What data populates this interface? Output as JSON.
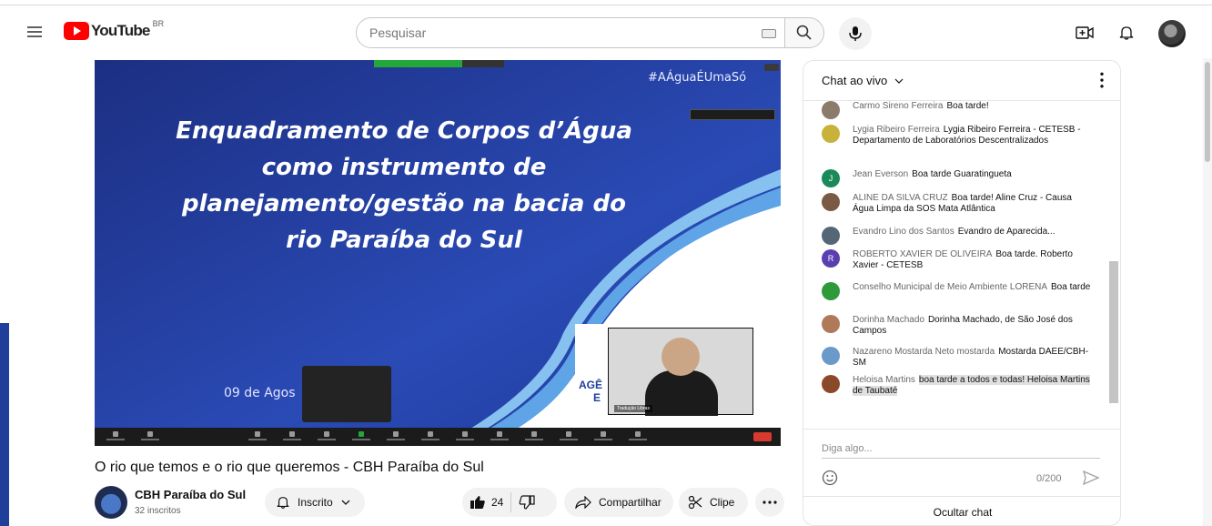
{
  "masthead": {
    "logo_text": "YouTube",
    "country_code": "BR",
    "search_placeholder": "Pesquisar"
  },
  "video": {
    "slide_title_lines": [
      "Enquadramento de Corpos d’Água",
      "como instrumento de",
      "planejamento/gestão na bacia do",
      "rio Paraíba do Sul"
    ],
    "slide_hashtag": "#AÁguaÉUmaSó",
    "slide_date": "09 de Agos",
    "logo_text_partial": "AGÊ",
    "logo_text_partial_2": "E",
    "pip_label": "Tradução Libras"
  },
  "title": "O rio que temos e o rio que queremos - CBH Paraíba do Sul",
  "channel": {
    "name": "CBH Paraíba do Sul",
    "subscribers": "32 inscritos"
  },
  "actions": {
    "subscribed_label": "Inscrito",
    "like_count": "24",
    "share_label": "Compartilhar",
    "clip_label": "Clipe"
  },
  "chat": {
    "header": "Chat ao vivo",
    "messages": [
      {
        "author": "Carmo Sireno Ferreira",
        "text": "Boa tarde!",
        "avatar_color": "#8a7b6a",
        "initial": ""
      },
      {
        "author": "Lygia Ribeiro Ferreira",
        "text": "Lygia Ribeiro Ferreira - CETESB - Departamento de Laboratórios Descentralizados",
        "avatar_color": "#c9b23a",
        "initial": ""
      },
      {
        "author": "Jean Everson",
        "text": "Boa tarde Guaratingueta",
        "avatar_color": "#1a8a5a",
        "initial": "J"
      },
      {
        "author": "ALINE DA SILVA CRUZ",
        "text": "Boa tarde! Aline Cruz - Causa Água Limpa da SOS Mata Atlântica",
        "avatar_color": "#7a5a44",
        "initial": ""
      },
      {
        "author": "Evandro Lino dos Santos",
        "text": "Evandro de Aparecida...",
        "avatar_color": "#556677",
        "initial": ""
      },
      {
        "author": "ROBERTO XAVIER DE OLIVEIRA",
        "text": "Boa tarde. Roberto Xavier - CETESB",
        "avatar_color": "#5a3fb0",
        "initial": "R"
      },
      {
        "author": "Conselho Municipal de Meio Ambiente LORENA",
        "text": "Boa tarde",
        "avatar_color": "#2e9a3a",
        "initial": ""
      },
      {
        "author": "Dorinha Machado",
        "text": "Dorinha Machado, de São José dos Campos",
        "avatar_color": "#b07a5a",
        "initial": ""
      },
      {
        "author": "Nazareno Mostarda Neto mostarda",
        "text": "Mostarda DAEE/CBH-SM",
        "avatar_color": "#6a9ac9",
        "initial": ""
      },
      {
        "author": "Heloisa Martins",
        "text": "boa tarde a todos e todas! Heloisa Martins de Taubaté",
        "avatar_color": "#8a4a2a",
        "initial": "",
        "highlight": true
      }
    ],
    "input_placeholder": "Diga algo...",
    "char_counter": "0/200",
    "hide_label": "Ocultar chat"
  }
}
